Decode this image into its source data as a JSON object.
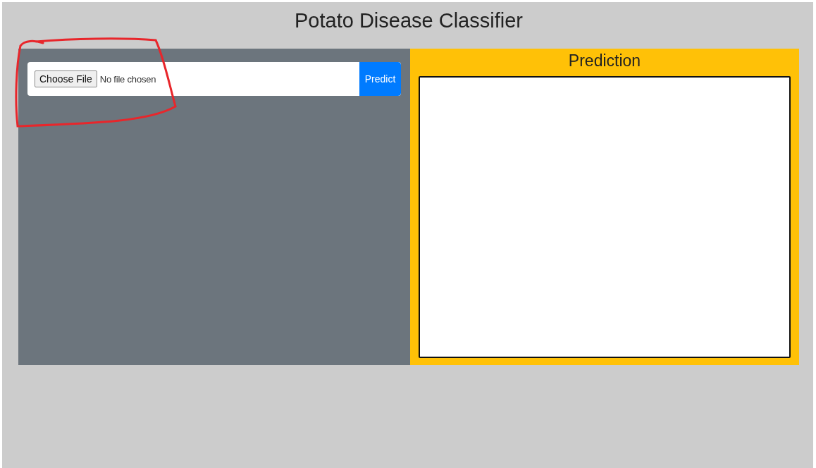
{
  "title": "Potato Disease Classifier",
  "upload": {
    "choose_button": "Choose File",
    "file_status": "No file chosen",
    "predict_button": "Predict"
  },
  "prediction": {
    "heading": "Prediction"
  }
}
